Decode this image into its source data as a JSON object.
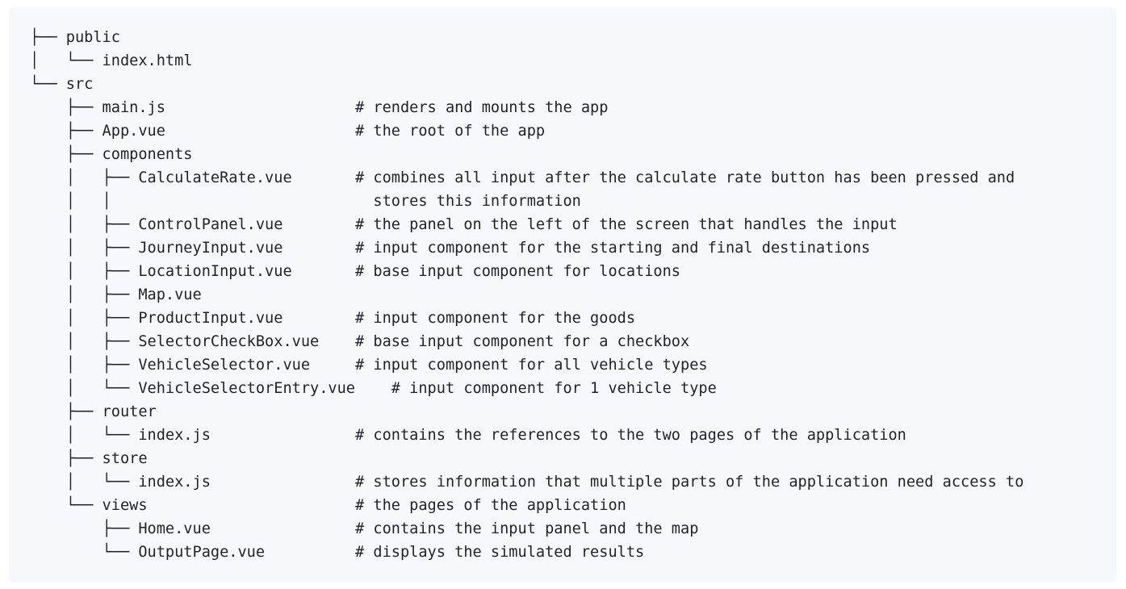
{
  "file_tree": {
    "lines": [
      "├── public",
      "│   └── index.html",
      "└── src",
      "    ├── main.js                     # renders and mounts the app",
      "    ├── App.vue                     # the root of the app",
      "    ├── components",
      "    │   ├── CalculateRate.vue       # combines all input after the calculate rate button has been pressed and",
      "    │   │                             stores this information",
      "    │   ├── ControlPanel.vue        # the panel on the left of the screen that handles the input",
      "    │   ├── JourneyInput.vue        # input component for the starting and final destinations",
      "    │   ├── LocationInput.vue       # base input component for locations",
      "    │   ├── Map.vue",
      "    │   ├── ProductInput.vue        # input component for the goods",
      "    │   ├── SelectorCheckBox.vue    # base input component for a checkbox",
      "    │   ├── VehicleSelector.vue     # input component for all vehicle types",
      "    │   └── VehicleSelectorEntry.vue    # input component for 1 vehicle type",
      "    ├── router",
      "    │   └── index.js                # contains the references to the two pages of the application",
      "    ├── store",
      "    │   └── index.js                # stores information that multiple parts of the application need access to",
      "    └── views                       # the pages of the application",
      "        ├── Home.vue                # contains the input panel and the map",
      "        └── OutputPage.vue          # displays the simulated results"
    ]
  }
}
